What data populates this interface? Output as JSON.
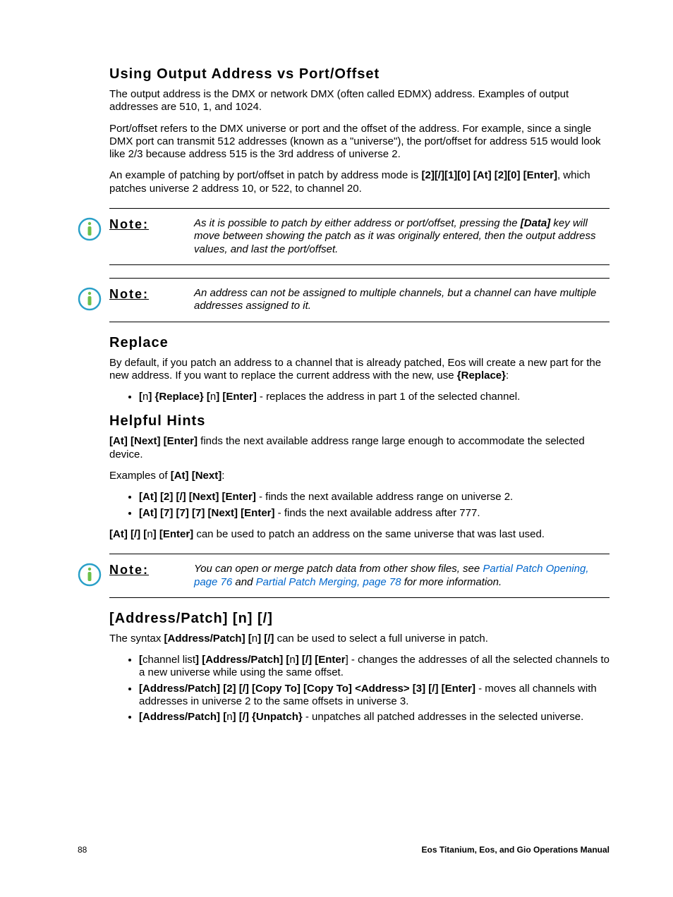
{
  "section1": {
    "heading": "Using Output Address vs Port/Offset",
    "p1": "The output address is the DMX or network DMX (often called EDMX) address. Examples of output addresses are 510, 1, and 1024.",
    "p2": "Port/offset refers to the DMX universe or port and the offset of the address. For example, since a single DMX port can transmit 512 addresses (known as a \"universe\"), the port/offset for address 515 would look like 2/3 because address 515 is the 3rd address of universe 2.",
    "p3_a": "An example of patching by port/offset in patch by address mode is ",
    "p3_b": "[2][/][1][0] [At] [2][0] [Enter]",
    "p3_c": ", which patches universe 2 address 10, or 522, to channel 20."
  },
  "note1": {
    "label": "Note:",
    "body_a": "As it is possible to patch by either address or port/offset, pressing the ",
    "body_b": "[Data]",
    "body_c": " key will move between showing the patch as it was originally entered, then the output address values, and last the port/offset."
  },
  "note2": {
    "label": "Note:",
    "body": "An address can not be assigned to multiple channels, but a channel can have multiple addresses assigned to it."
  },
  "section2": {
    "heading": "Replace",
    "p1_a": "By default, if you patch an address to a channel that is already patched, Eos will create a new part for the new address. If you want to replace the current address with the new, use ",
    "p1_b": "{Replace}",
    "p1_c": ":",
    "li1_a": "[",
    "li1_b": "n",
    "li1_c": "] {Replace} [",
    "li1_d": "n",
    "li1_e": "] [Enter]",
    "li1_f": " - replaces the address in part 1 of the selected channel."
  },
  "section3": {
    "heading": "Helpful Hints",
    "p1_a": "[At] [Next] [Enter]",
    "p1_b": " finds the next available address range large enough to accommodate the selected device.",
    "p2_a": "Examples of ",
    "p2_b": "[At] [Next]",
    "p2_c": ":",
    "li1_a": "[At] [2] [/] [Next] [Enter]",
    "li1_b": " - finds the next available address range on universe 2.",
    "li2_a": "[At] [7] [7] [7] [Next] [Enter]",
    "li2_b": " - finds the next available address after 777.",
    "p3_a": "[At] [/] [",
    "p3_b": "n",
    "p3_c": "] [Enter]",
    "p3_d": " can be used to patch an address on the same universe that was last used."
  },
  "note3": {
    "label": "Note:",
    "body_a": "You can open or merge patch data from other show files, see ",
    "link1": "Partial Patch Opening, page 76",
    "body_b": " and ",
    "link2": "Partial Patch Merging, page 78",
    "body_c": " for more information."
  },
  "section4": {
    "heading": "[Address/Patch] [n] [/]",
    "p1_a": "The syntax ",
    "p1_b": "[Address/Patch] [",
    "p1_c": "n",
    "p1_d": "] [/]",
    "p1_e": " can be used to select a full universe in patch.",
    "li1_a": "[",
    "li1_b": "channel list",
    "li1_c": "] [Address/Patch] [",
    "li1_d": "n",
    "li1_e": "] [/] [Enter",
    "li1_f": "] - changes the addresses of all the selected channels to a new universe while using the same offset.",
    "li2_a": "[Address/Patch] [2] [/] [Copy To] [Copy To] <Address> [3] [/] [Enter]",
    "li2_b": " - moves all channels with addresses in universe 2 to the same offsets in universe 3.",
    "li3_a": "[Address/Patch] [",
    "li3_b": "n",
    "li3_c": "] [/] {Unpatch}",
    "li3_d": " - unpatches all patched addresses in the selected universe."
  },
  "footer": {
    "page": "88",
    "title": "Eos Titanium, Eos, and Gio Operations Manual"
  }
}
